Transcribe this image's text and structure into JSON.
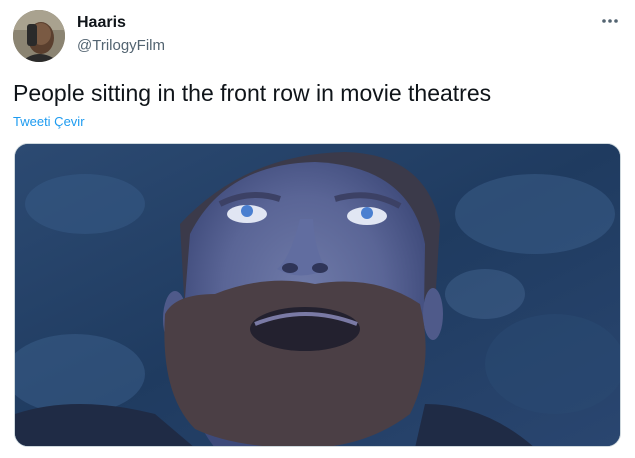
{
  "author": {
    "display_name": "Haaris",
    "handle": "@TrilogyFilm",
    "avatar_icon": "profile-photo"
  },
  "tweet": {
    "text": "People sitting in the front row in movie theatres",
    "translate_label": "Tweeti Çevir"
  },
  "actions": {
    "more_icon": "more-horizontal-icon"
  },
  "colors": {
    "link": "#1d9bf0",
    "text_primary": "#0f1419",
    "text_secondary": "#536471"
  }
}
